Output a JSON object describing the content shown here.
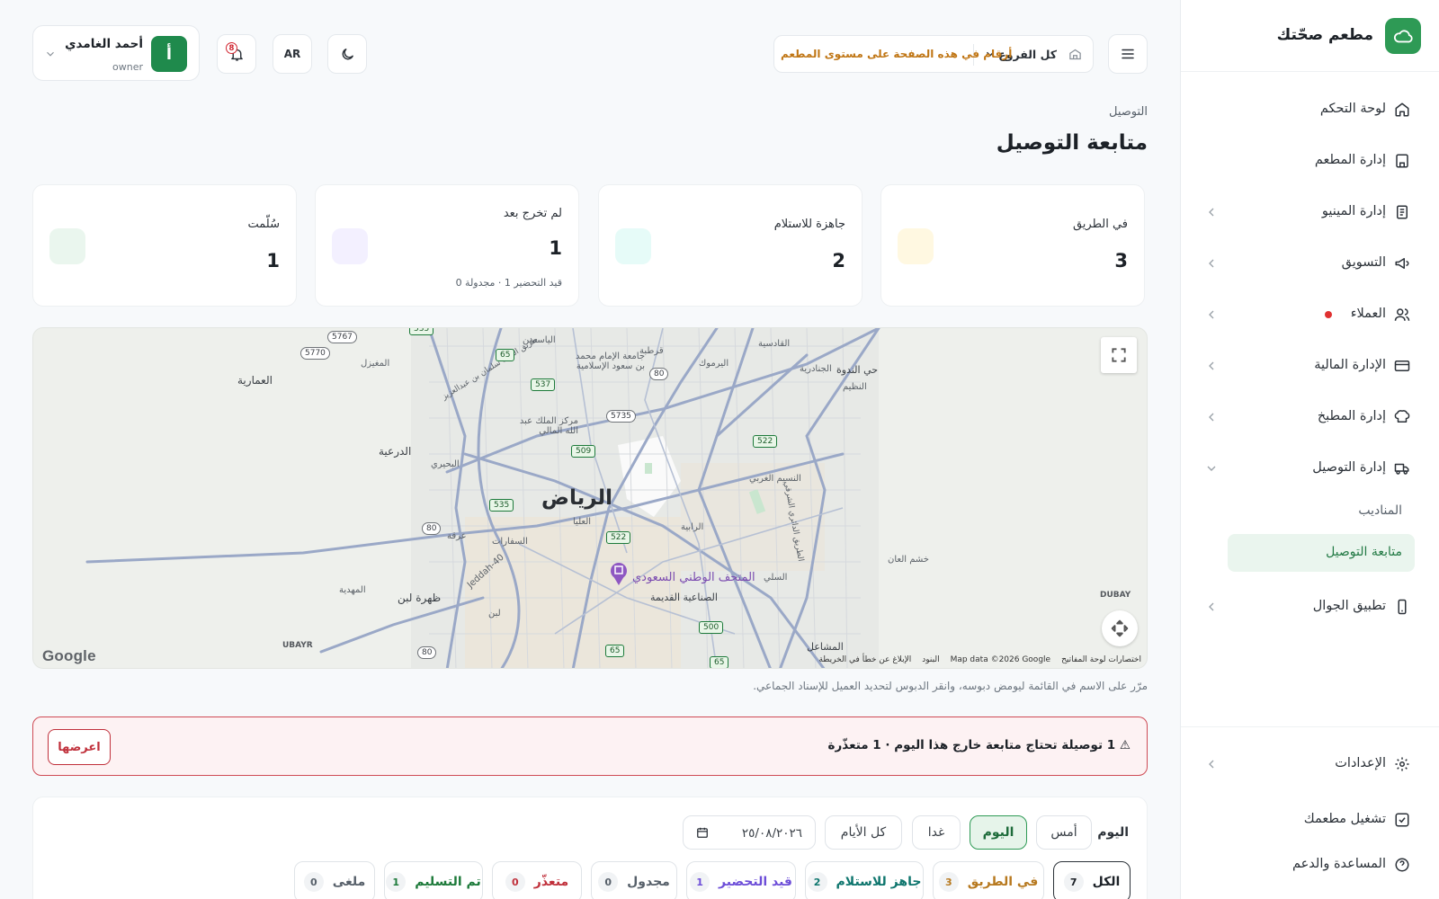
{
  "brand": {
    "name": "مطعم صحّتك"
  },
  "sidebar": {
    "items": [
      {
        "label": "لوحة التحكم",
        "icon": "home-icon"
      },
      {
        "label": "إدارة المطعم",
        "icon": "store-icon"
      },
      {
        "label": "إدارة المينيو",
        "icon": "menu-book-icon"
      },
      {
        "label": "التسويق",
        "icon": "megaphone-icon"
      },
      {
        "label": "العملاء",
        "icon": "users-icon"
      },
      {
        "label": "الإدارة المالية",
        "icon": "credit-card-icon"
      },
      {
        "label": "إدارة المطبخ",
        "icon": "chef-hat-icon"
      },
      {
        "label": "إدارة التوصيل",
        "icon": "truck-icon"
      },
      {
        "label": "تطبيق الجوال",
        "icon": "smartphone-icon"
      }
    ],
    "delivery_sub": [
      {
        "label": "المناديب"
      },
      {
        "label": "متابعة التوصيل"
      }
    ],
    "bottom": [
      {
        "label": "الإعدادات",
        "icon": "gear-icon"
      },
      {
        "label": "تشغيل مطعمك",
        "icon": "checkbox-icon"
      },
      {
        "label": "المساعدة والدعم",
        "icon": "help-circle-icon"
      }
    ],
    "customers_dot_color": "#e03131"
  },
  "topbar": {
    "branch_select": "كل الفروع",
    "branch_note": "أرقام في هذه الصفحة على مستوى المطعم",
    "language": "AR",
    "notifications_count": "8",
    "user": {
      "initial": "أ",
      "name": "أحمد الغامدي",
      "role": "owner"
    }
  },
  "page": {
    "breadcrumb": "التوصيل",
    "title": "متابعة التوصيل"
  },
  "stats": [
    {
      "label": "في الطريق",
      "value": "3",
      "color": "#fff8e1"
    },
    {
      "label": "جاهزة للاستلام",
      "value": "2",
      "color": "#e6fbf8"
    },
    {
      "label": "لم تخرج بعد",
      "value": "1",
      "sub": "قيد التحضير 1 · مجدولة 0",
      "color": "#f3f0ff"
    },
    {
      "label": "سُلّمت",
      "value": "1",
      "color": "#eaf6ee"
    }
  ],
  "map": {
    "city": "الرياض",
    "poi": "المتحف الوطني السعودي",
    "labels": {
      "ammariyah": "العمارية",
      "diriyah": "الدرعية",
      "laban": "ظهرة لبن",
      "ndwa": "حي الندوة",
      "naseem": "النسيم الغربي",
      "sinaiyah": "الصناعية القديمة",
      "mashael": "المشاعل",
      "muhadiyah": "المهدية",
      "uraija": "عرقة",
      "safarat": "السفارات",
      "malaz": "الرابية",
      "qurtubah": "قرطبة",
      "yarmuk": "اليرموك",
      "imam": "جامعة الإمام محمد بن سعود الإسلامية",
      "kingAbdullah": "مركز الملك عبد الله المالي",
      "yasmin": "الياسمين",
      "qadisiyah": "القادسية",
      "naseem2": "الجنادرية",
      "nazim": "النظيم",
      "ulaya": "العليا",
      "suli": "السلي",
      "khashm": "خشم العان",
      "laban2": "لبن",
      "buhairi": "البحيري",
      "mughaizil": "المغيزل",
      "ring_road": "الطريق الدائري الشرقي",
      "jeddah": "Jeddah-40",
      "dubay": "DUBAY",
      "ubayr": "UBAYR",
      "king_salman": "طريق الملك سلمان بن عبدالعزيز"
    },
    "shields": [
      "535",
      "5767",
      "5770",
      "65",
      "537",
      "80",
      "5735",
      "509",
      "522",
      "535",
      "80",
      "522",
      "500",
      "65",
      "65",
      "80"
    ],
    "attribution": [
      "اختصارات لوحة المفاتيح",
      "Map data ©2026 Google",
      "البنود",
      "الإبلاغ عن خطأ في الخريطة"
    ],
    "google": "Google",
    "hint": "مرّر على الاسم في القائمة ليومض دبوسه، وانقر الدبوس لتحديد العميل للإسناد الجماعي."
  },
  "alert": {
    "text": "⚠ 1 توصيلة تحتاج متابعة خارج هذا اليوم · 1 متعذّرة",
    "button": "اعرضها"
  },
  "filters": {
    "day_title": "اليوم",
    "days": [
      "أمس",
      "اليوم",
      "غدا",
      "كل الأيام"
    ],
    "date": "٢٥/٠٨/٢٠٢٦",
    "statuses": [
      {
        "label": "الكل",
        "count": "7",
        "color": "#1c2127",
        "count_color": "#1c2127"
      },
      {
        "label": "في الطريق",
        "count": "3",
        "color": "#b7791f",
        "count_color": "#b7791f"
      },
      {
        "label": "جاهز للاستلام",
        "count": "2",
        "color": "#0f766e",
        "count_color": "#0f766e"
      },
      {
        "label": "قيد التحضير",
        "count": "1",
        "color": "#6d4ed8",
        "count_color": "#6d4ed8"
      },
      {
        "label": "مجدول",
        "count": "0",
        "color": "#57606a",
        "count_color": "#57606a"
      },
      {
        "label": "متعذّر",
        "count": "0",
        "color": "#c0303b",
        "count_color": "#c0303b"
      },
      {
        "label": "تم التسليم",
        "count": "1",
        "color": "#1d7a3a",
        "count_color": "#1d7a3a"
      },
      {
        "label": "ملغى",
        "count": "0",
        "color": "#57606a",
        "count_color": "#57606a"
      }
    ]
  }
}
